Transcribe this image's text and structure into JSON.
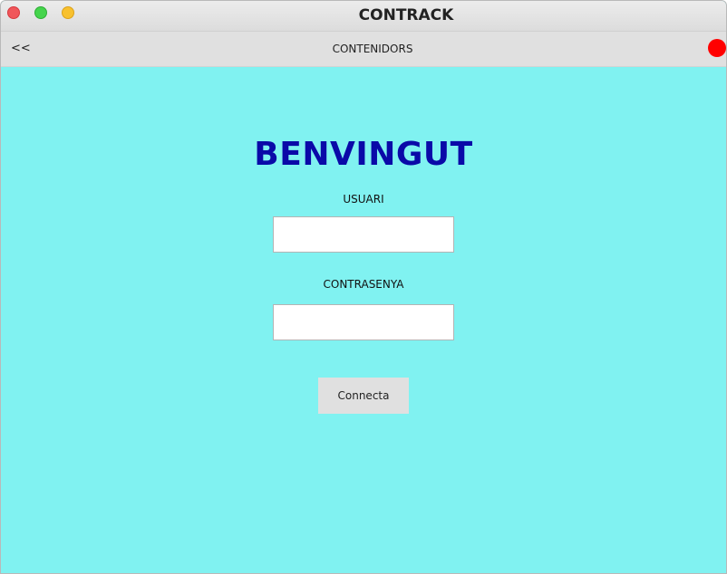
{
  "window": {
    "title": "CONTRACK",
    "controls": [
      {
        "name": "close",
        "color": "#f0565a"
      },
      {
        "name": "maximize",
        "color": "#45d44c"
      },
      {
        "name": "minimize",
        "color": "#f8c12f"
      }
    ]
  },
  "navbar": {
    "back_label": "<<",
    "title": "CONTENIDORS",
    "status_color": "#ff0000"
  },
  "login": {
    "heading": "BENVINGUT",
    "username_label": "USUARI",
    "username_value": "",
    "password_label": "CONTRASENYA",
    "password_value": "",
    "connect_label": "Connecta"
  },
  "colors": {
    "background": "#80f2f1",
    "heading": "#0a0aa8",
    "navbar": "#e0e0e0",
    "button": "#e0e0e0"
  }
}
